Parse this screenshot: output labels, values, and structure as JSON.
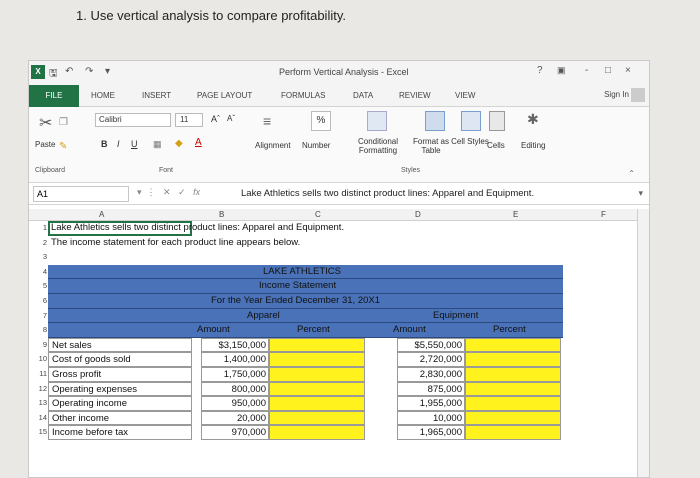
{
  "question": "1. Use vertical analysis to compare profitability.",
  "window": {
    "title": "Perform Vertical Analysis - Excel",
    "help": "?",
    "controls": [
      "-",
      "□",
      "×"
    ]
  },
  "tabs": [
    "FILE",
    "HOME",
    "INSERT",
    "PAGE LAYOUT",
    "FORMULAS",
    "DATA",
    "REVIEW",
    "VIEW"
  ],
  "sign_in": "Sign In",
  "ribbon": {
    "paste": "Paste",
    "font_name": "Calibri",
    "font_size": "11",
    "font_grow": "Aˆ",
    "font_shrink": "Aˇ",
    "bold": "B",
    "italic": "I",
    "underline": "U",
    "alignment": "Alignment",
    "number": "Number",
    "conditional_formatting": "Conditional Formatting",
    "format_as_table": "Format as Table",
    "cell_styles": "Cell Styles",
    "cells": "Cells",
    "editing": "Editing",
    "percent": "%",
    "groups": {
      "clipboard": "Clipboard",
      "font": "Font",
      "styles": "Styles"
    }
  },
  "formula_bar": {
    "name_box": "A1",
    "fx": "fx",
    "content": "Lake Athletics sells two distinct product lines: Apparel and Equipment."
  },
  "columns": [
    "A",
    "B",
    "C",
    "D",
    "E",
    "F"
  ],
  "sheet": {
    "row1": "Lake Athletics sells two distinct product lines: Apparel and Equipment.",
    "row2": "The income statement for each product line appears below.",
    "company": "LAKE ATHLETICS",
    "statement": "Income Statement",
    "period": "For the Year Ended December 31, 20X1",
    "apparel": "Apparel",
    "equipment": "Equipment",
    "amount": "Amount",
    "percent": "Percent",
    "items": [
      {
        "row": "9",
        "label": "Net sales",
        "apparel": "$3,150,000",
        "equipment": "$5,550,000"
      },
      {
        "row": "10",
        "label": "Cost of goods sold",
        "apparel": "1,400,000",
        "equipment": "2,720,000"
      },
      {
        "row": "11",
        "label": "Gross profit",
        "apparel": "1,750,000",
        "equipment": "2,830,000"
      },
      {
        "row": "12",
        "label": "Operating expenses",
        "apparel": "800,000",
        "equipment": "875,000"
      },
      {
        "row": "13",
        "label": "Operating income",
        "apparel": "950,000",
        "equipment": "1,955,000"
      },
      {
        "row": "14",
        "label": "Other income",
        "apparel": "20,000",
        "equipment": "10,000"
      },
      {
        "row": "15",
        "label": "Income before tax",
        "apparel": "970,000",
        "equipment": "1,965,000"
      }
    ]
  }
}
